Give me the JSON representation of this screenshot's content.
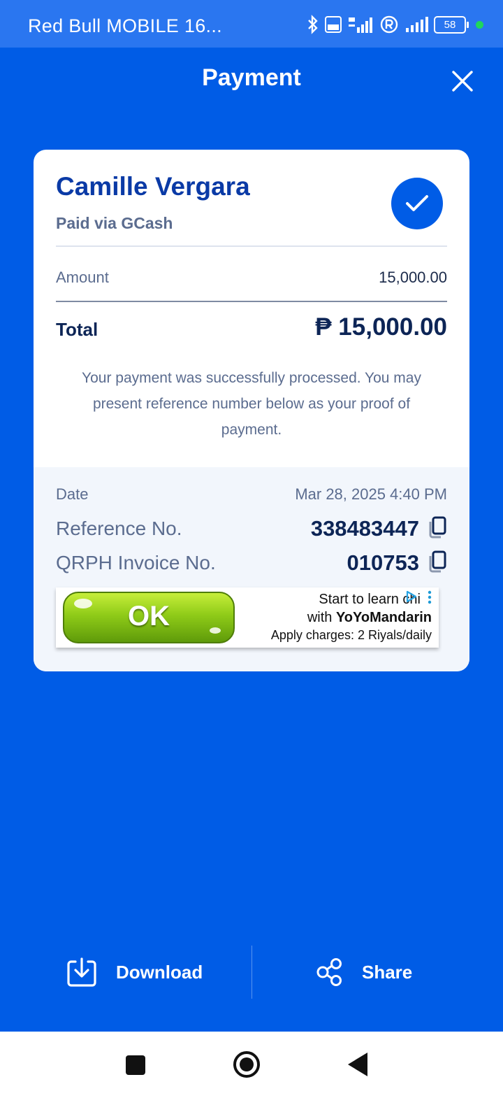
{
  "status_bar": {
    "carrier": "Red Bull MOBILE  16...",
    "battery": "58"
  },
  "header": {
    "title": "Payment"
  },
  "receipt": {
    "payer_name": "Camille Vergara",
    "paid_via": "Paid via GCash",
    "amount_label": "Amount",
    "amount_value": "15,000.00",
    "total_label": "Total",
    "total_value": "₱ 15,000.00",
    "message": "Your payment was successfully processed. You may present reference number below as your proof of payment.",
    "date_label": "Date",
    "date_value": "Mar 28, 2025 4:40 PM",
    "reference_label": "Reference No.",
    "reference_value": "338483447",
    "invoice_label": "QRPH Invoice No.",
    "invoice_value": "010753"
  },
  "ad": {
    "button_text": "OK",
    "line1": "Start to learn chi",
    "line2_prefix": "with ",
    "line2_brand": "YoYoMandarin",
    "line3": "Apply charges: 2 Riyals/daily"
  },
  "actions": {
    "download_label": "Download",
    "share_label": "Share"
  },
  "colors": {
    "background": "#005ce6",
    "status_bar": "#2a76f0",
    "accent": "#005ce6",
    "heading": "#0a3aa6",
    "text_dark": "#0d2556",
    "text_muted": "#5b6c8f"
  },
  "icons": {
    "close": "close-icon",
    "check": "checkmark-icon",
    "copy": "copy-icon",
    "download": "download-icon",
    "share": "share-icon"
  }
}
